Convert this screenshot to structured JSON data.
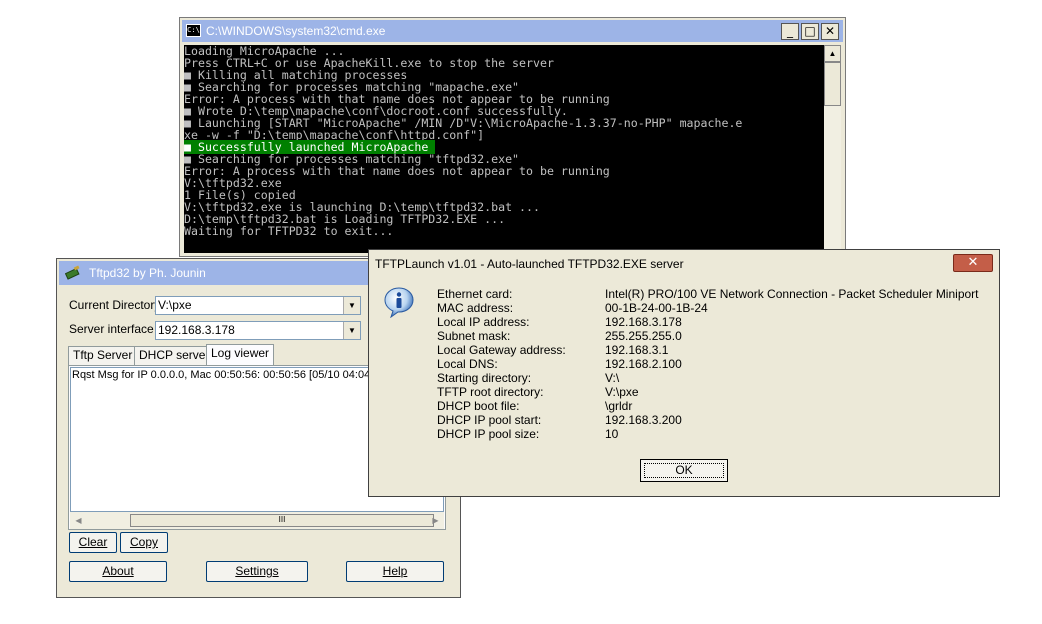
{
  "cmd": {
    "title": "C:\\WINDOWS\\system32\\cmd.exe",
    "icon_text": "C:\\",
    "lines": [
      "Loading MicroApache ...",
      "Press CTRL+C or use ApacheKill.exe to stop the server",
      "■ Killing all matching processes",
      "■ Searching for processes matching \"mapache.exe\"",
      "Error: A process with that name does not appear to be running",
      "■ Wrote D:\\temp\\mapache\\conf\\docroot.conf successfully.",
      "■ Launching [START \"MicroApache\" /MIN /D\"V:\\MicroApache-1.3.37-no-PHP\" mapache.e",
      "xe -w -f \"D:\\temp\\mapache\\conf\\httpd.conf\"]"
    ],
    "highlight_line": "■ Successfully launched MicroApache ",
    "lines_after": [
      "■ Searching for processes matching \"tftpd32.exe\"",
      "Error: A process with that name does not appear to be running",
      "V:\\tftpd32.exe",
      "1 File(s) copied",
      "V:\\tftpd32.exe is launching D:\\temp\\tftpd32.bat ...",
      "D:\\temp\\tftpd32.bat is Loading TFTPD32.EXE ...",
      "Waiting for TFTPD32 to exit..."
    ],
    "buttons": {
      "minimize": "_",
      "maximize": "□",
      "close": "✕"
    }
  },
  "tftpd": {
    "title": "Tftpd32 by Ph. Jounin",
    "current_directory_label": "Current Directory",
    "current_directory_value": "V:\\pxe",
    "server_interface_label": "Server interface",
    "server_interface_value": "192.168.3.178",
    "tabs": [
      "Tftp Server",
      "DHCP server",
      "Log viewer"
    ],
    "active_tab": "Log viewer",
    "log_line": "Rqst Msg for IP 0.0.0.0, Mac 00:50:56: 00:50:56 [05/10 04:04",
    "scroll_thumb": "III",
    "buttons": {
      "clear": "Clear",
      "copy": "Copy",
      "about": "About",
      "settings": "Settings",
      "help": "Help"
    }
  },
  "launch": {
    "title": "TFTPLaunch v1.01 - Auto-launched TFTPD32.EXE server",
    "close": "✕",
    "fields": [
      {
        "key": "Ethernet card:",
        "value": "Intel(R) PRO/100 VE Network Connection - Packet Scheduler Miniport"
      },
      {
        "key": "MAC address:",
        "value": "00-1B-24-00-1B-24"
      },
      {
        "key": "Local IP address:",
        "value": "192.168.3.178"
      },
      {
        "key": "Subnet mask:",
        "value": "255.255.255.0"
      },
      {
        "key": "Local Gateway address:",
        "value": "192.168.3.1"
      },
      {
        "key": "Local DNS:",
        "value": "192.168.2.100"
      },
      {
        "key": "Starting directory:",
        "value": "V:\\"
      },
      {
        "key": "TFTP root directory:",
        "value": "V:\\pxe"
      },
      {
        "key": "DHCP boot file:",
        "value": "\\grldr"
      },
      {
        "key": "DHCP IP pool start:",
        "value": "192.168.3.200"
      },
      {
        "key": "DHCP IP pool size:",
        "value": "10"
      }
    ],
    "ok": "OK"
  },
  "colors": {
    "console_bg": "#000000",
    "console_text": "#c0c0c0",
    "console_highlight": "#008000",
    "inactive_titlebar": "#9db4e7",
    "close_button": "#c45e48"
  }
}
